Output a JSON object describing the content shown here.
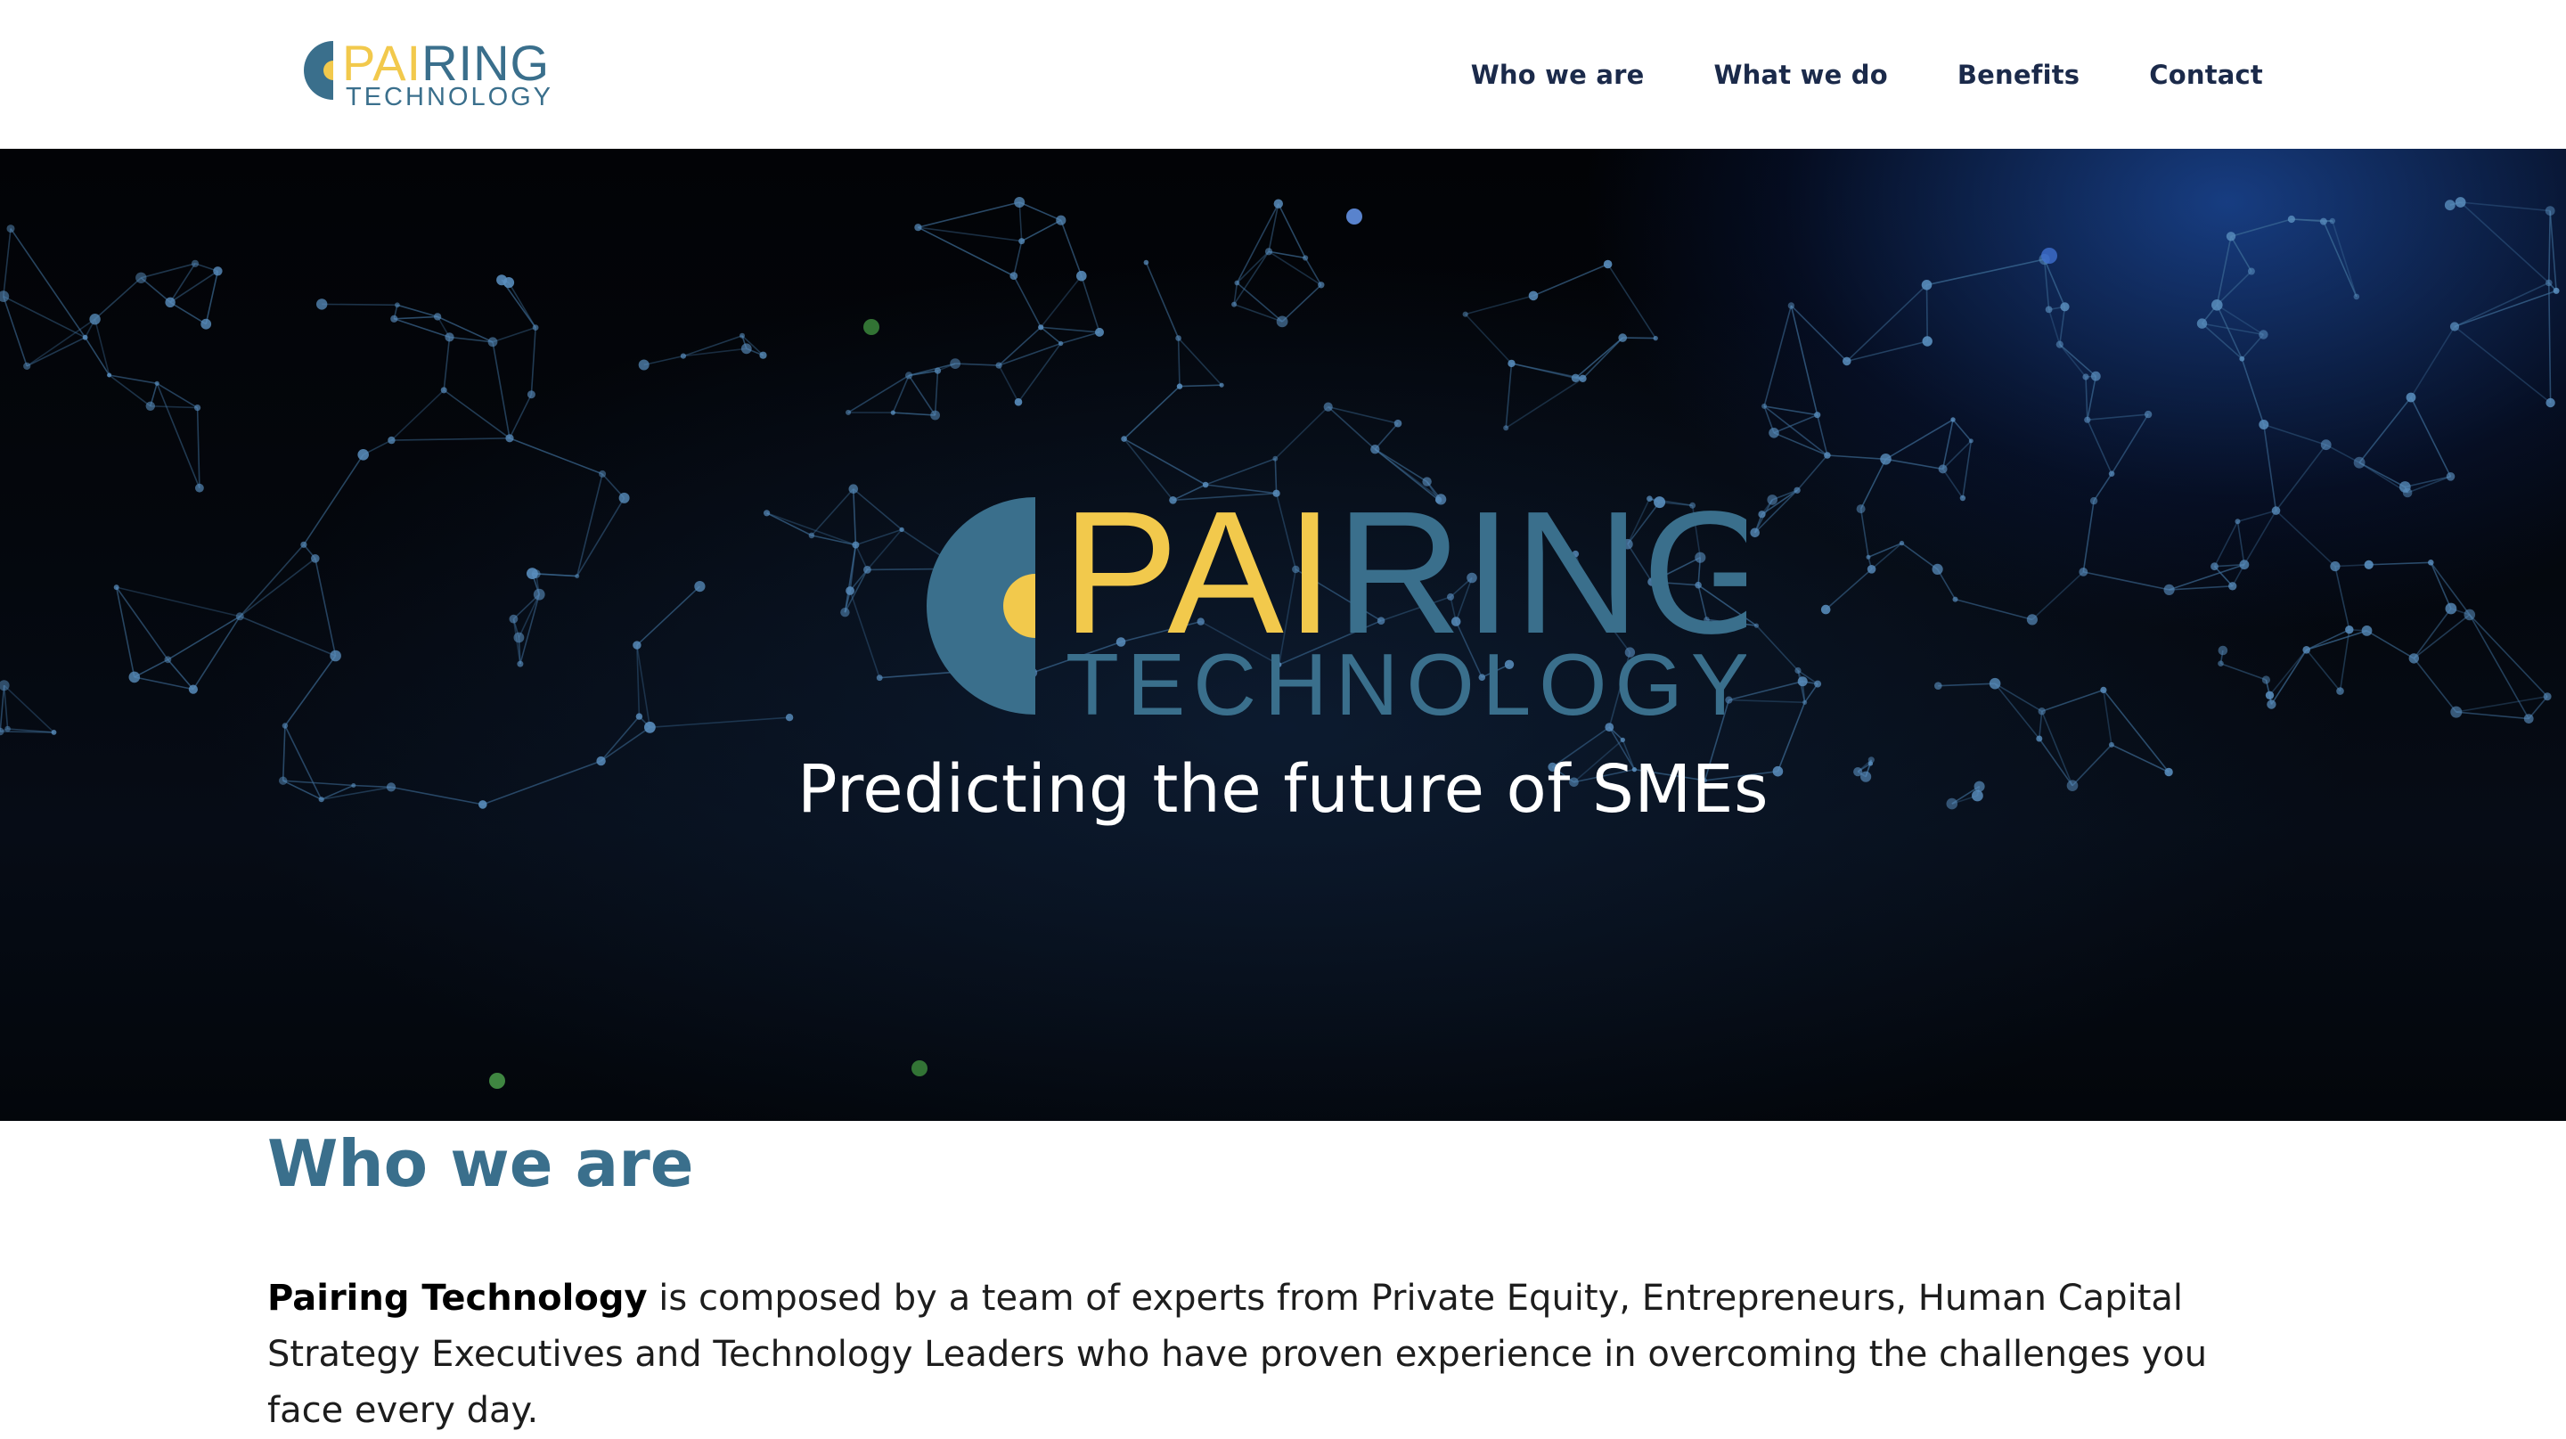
{
  "brand": {
    "name_left": "PAI",
    "name_right": "RING",
    "subtitle": "TECHNOLOGY",
    "colors": {
      "teal": "#3a6f8c",
      "yellow": "#f2c94c"
    }
  },
  "nav": {
    "items": [
      {
        "label": "Who we are"
      },
      {
        "label": "What we do"
      },
      {
        "label": "Benefits"
      },
      {
        "label": "Contact"
      }
    ]
  },
  "hero": {
    "tagline": "Predicting the future of SMEs"
  },
  "who_we_are": {
    "title": "Who we are",
    "company": "Pairing Technology",
    "text": " is composed by a team of experts from Private Equity, Entrepreneurs, Human Capital Strategy Executives and Technology Leaders who have proven experience in overcoming the challenges you face every day."
  }
}
